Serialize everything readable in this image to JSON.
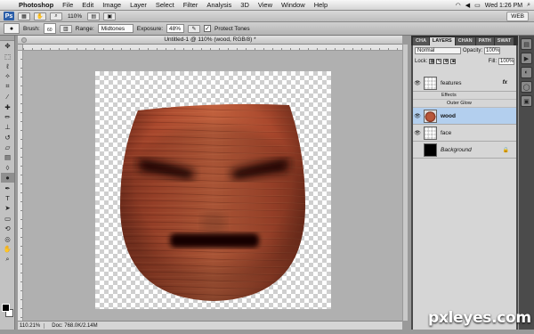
{
  "menubar": {
    "app": "Photoshop",
    "items": [
      "File",
      "Edit",
      "Image",
      "Layer",
      "Select",
      "Filter",
      "Analysis",
      "3D",
      "View",
      "Window",
      "Help"
    ],
    "clock": "Wed 1:26 PM"
  },
  "appbar": {
    "logo": "Ps",
    "zoom": "110%",
    "workspace": "WEB"
  },
  "options": {
    "brush_label": "Brush:",
    "brush_size": "60",
    "range_label": "Range:",
    "range_value": "Midtones",
    "exposure_label": "Exposure:",
    "exposure_value": "48%",
    "protect_tones_label": "Protect Tones",
    "protect_tones_checked": true
  },
  "document": {
    "title": "Untitled-1 @ 110% (wood, RGB/8) *",
    "status_zoom": "110.21%",
    "status_doc": "Doc: 768.0K/2.14M"
  },
  "layers_panel": {
    "tabs": [
      "CHA",
      "LAYERS",
      "CHAN",
      "PATH",
      "SWAT"
    ],
    "active_tab": "LAYERS",
    "blend_mode": "Normal",
    "opacity_label": "Opacity:",
    "opacity": "100%",
    "lock_label": "Lock:",
    "fill_label": "Fill:",
    "fill": "100%",
    "layers": [
      {
        "name": "features",
        "visible": true,
        "selected": false,
        "fx": "fx",
        "thumb": "checker"
      },
      {
        "name": "wood",
        "visible": true,
        "selected": true,
        "thumb": "wood"
      },
      {
        "name": "face",
        "visible": true,
        "selected": false,
        "thumb": "checker"
      },
      {
        "name": "Background",
        "visible": false,
        "selected": false,
        "thumb": "black",
        "locked": true
      }
    ],
    "effects_label": "Effects",
    "outer_glow_label": "Outer Glow"
  },
  "watermark": "pxleyes.com",
  "colors": {
    "wood_light": "#b8573a",
    "wood_dark": "#7a2e1e",
    "selection": "#b3cfee",
    "panel_dark": "#4a4a4a"
  }
}
